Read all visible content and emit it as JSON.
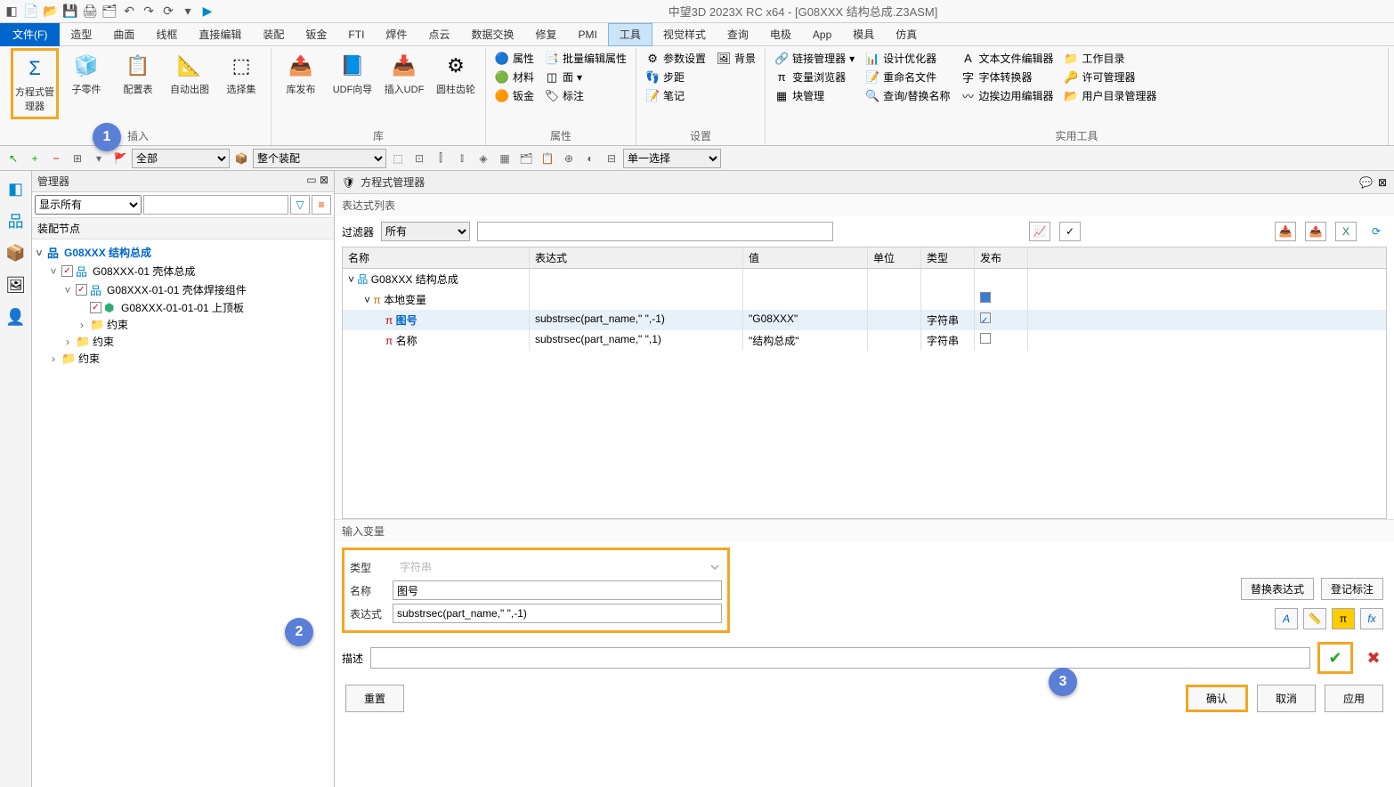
{
  "app_title": "中望3D 2023X RC x64 - [G08XXX 结构总成.Z3ASM]",
  "menus": {
    "file": "文件(F)",
    "items": [
      "造型",
      "曲面",
      "线框",
      "直接编辑",
      "装配",
      "钣金",
      "FTI",
      "焊件",
      "点云",
      "数据交换",
      "修复",
      "PMI",
      "工具",
      "视觉样式",
      "查询",
      "电极",
      "App",
      "模具",
      "仿真"
    ]
  },
  "ribbon": {
    "insert": {
      "label": "插入",
      "eq_mgr": "方程式管理器",
      "sub_part": "子零件",
      "config": "配置表",
      "auto_draw": "自动出图",
      "sel_set": "选择集"
    },
    "lib": {
      "label": "库",
      "pub": "库发布",
      "udf_guide": "UDF向导",
      "insert_udf": "插入UDF",
      "gear": "圆柱齿轮"
    },
    "attr": {
      "label": "属性",
      "r1": [
        "属性",
        "批量编辑属性"
      ],
      "r2": [
        "材料",
        "面"
      ],
      "r3": [
        "钣金",
        "标注"
      ]
    },
    "setting": {
      "label": "设置",
      "r": [
        "参数设置",
        "背景",
        "步距",
        "笔记"
      ]
    },
    "util": {
      "label": "实用工具",
      "col1": [
        "链接管理器",
        "变量浏览器",
        "块管理"
      ],
      "col2": [
        "设计优化器",
        "重命名文件",
        "查询/替换名称"
      ],
      "col3": [
        "文本文件编辑器",
        "字体转换器",
        "边挨边用编辑器"
      ],
      "col4": [
        "工作目录",
        "许可管理器",
        "用户目录管理器"
      ]
    }
  },
  "sel_toolbar": {
    "filter1": "全部",
    "filter2": "整个装配",
    "mode": "单一选择"
  },
  "manager": {
    "title": "管理器",
    "show": "显示所有",
    "node_title": "装配节点",
    "tree": {
      "root": "G08XXX 结构总成",
      "n1": "G08XXX-01 壳体总成",
      "n2": "G08XXX-01-01 壳体焊接组件",
      "n3": "G08XXX-01-01-01 上顶板",
      "constraint": "约束"
    }
  },
  "eq": {
    "title": "方程式管理器",
    "list_label": "表达式列表",
    "filter_label": "过滤器",
    "filter_value": "所有",
    "headers": {
      "name": "名称",
      "exp": "表达式",
      "val": "值",
      "unit": "单位",
      "type": "类型",
      "pub": "发布"
    },
    "rows": {
      "r0": "G08XXX 结构总成",
      "r1": "本地变量",
      "r2": {
        "name": "图号",
        "exp": "substrsec(part_name,\" \",-1)",
        "val": "\"G08XXX\"",
        "type": "字符串"
      },
      "r3": {
        "name": "名称",
        "exp": "substrsec(part_name,\" \",1)",
        "val": "\"结构总成\"",
        "type": "字符串"
      }
    },
    "input_label": "输入变量",
    "form": {
      "type_label": "类型",
      "type_val": "字符串",
      "name_label": "名称",
      "name_val": "图号",
      "exp_label": "表达式",
      "exp_val": "substrsec(part_name,\" \",-1)"
    },
    "side": {
      "replace": "替换表达式",
      "reg": "登记标注"
    },
    "desc_label": "描述",
    "footer": {
      "reset": "重置",
      "ok": "确认",
      "cancel": "取消",
      "apply": "应用"
    }
  }
}
